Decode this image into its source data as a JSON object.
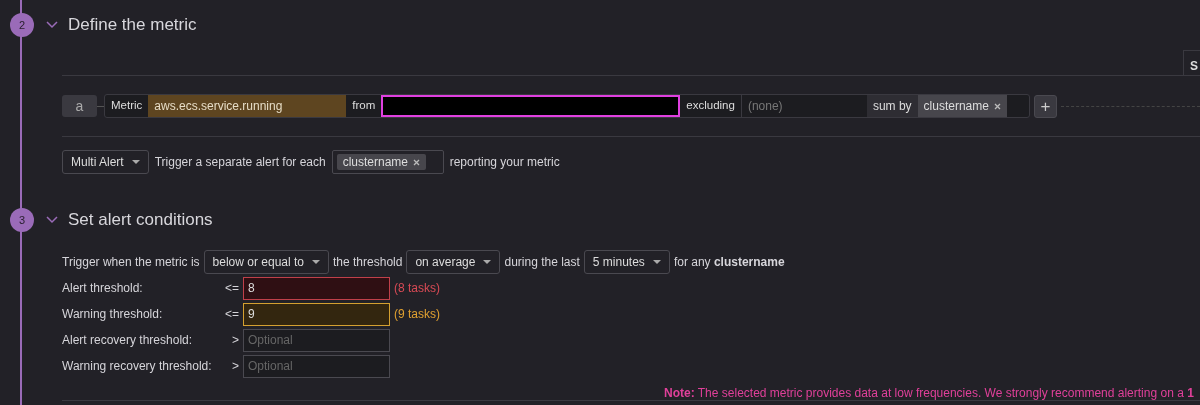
{
  "steps": [
    {
      "number": "2",
      "title": "Define the metric"
    },
    {
      "number": "3",
      "title": "Set alert conditions"
    }
  ],
  "side_tab": {
    "label": "S"
  },
  "query": {
    "letter": "a",
    "metric_label": "Metric",
    "metric": "aws.ecs.service.running",
    "from_label": "from",
    "excluding_label": "excluding",
    "excluding_placeholder": "(none)",
    "sum_by_label": "sum by",
    "sum_by_tags": [
      "clustername"
    ],
    "add_button": "+"
  },
  "multi_alert": {
    "mode": "Multi Alert",
    "text_before": "Trigger a separate alert for each",
    "tags": [
      "clustername"
    ],
    "text_after": "reporting your metric"
  },
  "trigger": [
    {
      "kind": "text",
      "text": "Trigger when the metric is"
    },
    {
      "kind": "select",
      "text": "below or equal to"
    },
    {
      "kind": "text",
      "text": "the threshold"
    },
    {
      "kind": "select",
      "text": "on average"
    },
    {
      "kind": "text",
      "text": "during the last"
    },
    {
      "kind": "select",
      "text": "5 minutes"
    },
    {
      "kind": "text",
      "text": "for any **clustername**"
    }
  ],
  "thresholds": [
    {
      "kind": "alert",
      "label": "Alert threshold:",
      "operator": "<=",
      "value": "8",
      "hint": "(8 tasks)"
    },
    {
      "kind": "warning",
      "label": "Warning threshold:",
      "operator": "<=",
      "value": "9",
      "hint": "(9 tasks)"
    },
    {
      "kind": "recovery",
      "label": "Alert recovery threshold:",
      "operator": ">",
      "placeholder": "Optional"
    },
    {
      "kind": "recovery",
      "label": "Warning recovery threshold:",
      "operator": ">",
      "placeholder": "Optional"
    }
  ],
  "note": "**Note:** The selected metric provides data at low frequencies. We strongly recommend alerting on a **1**"
}
